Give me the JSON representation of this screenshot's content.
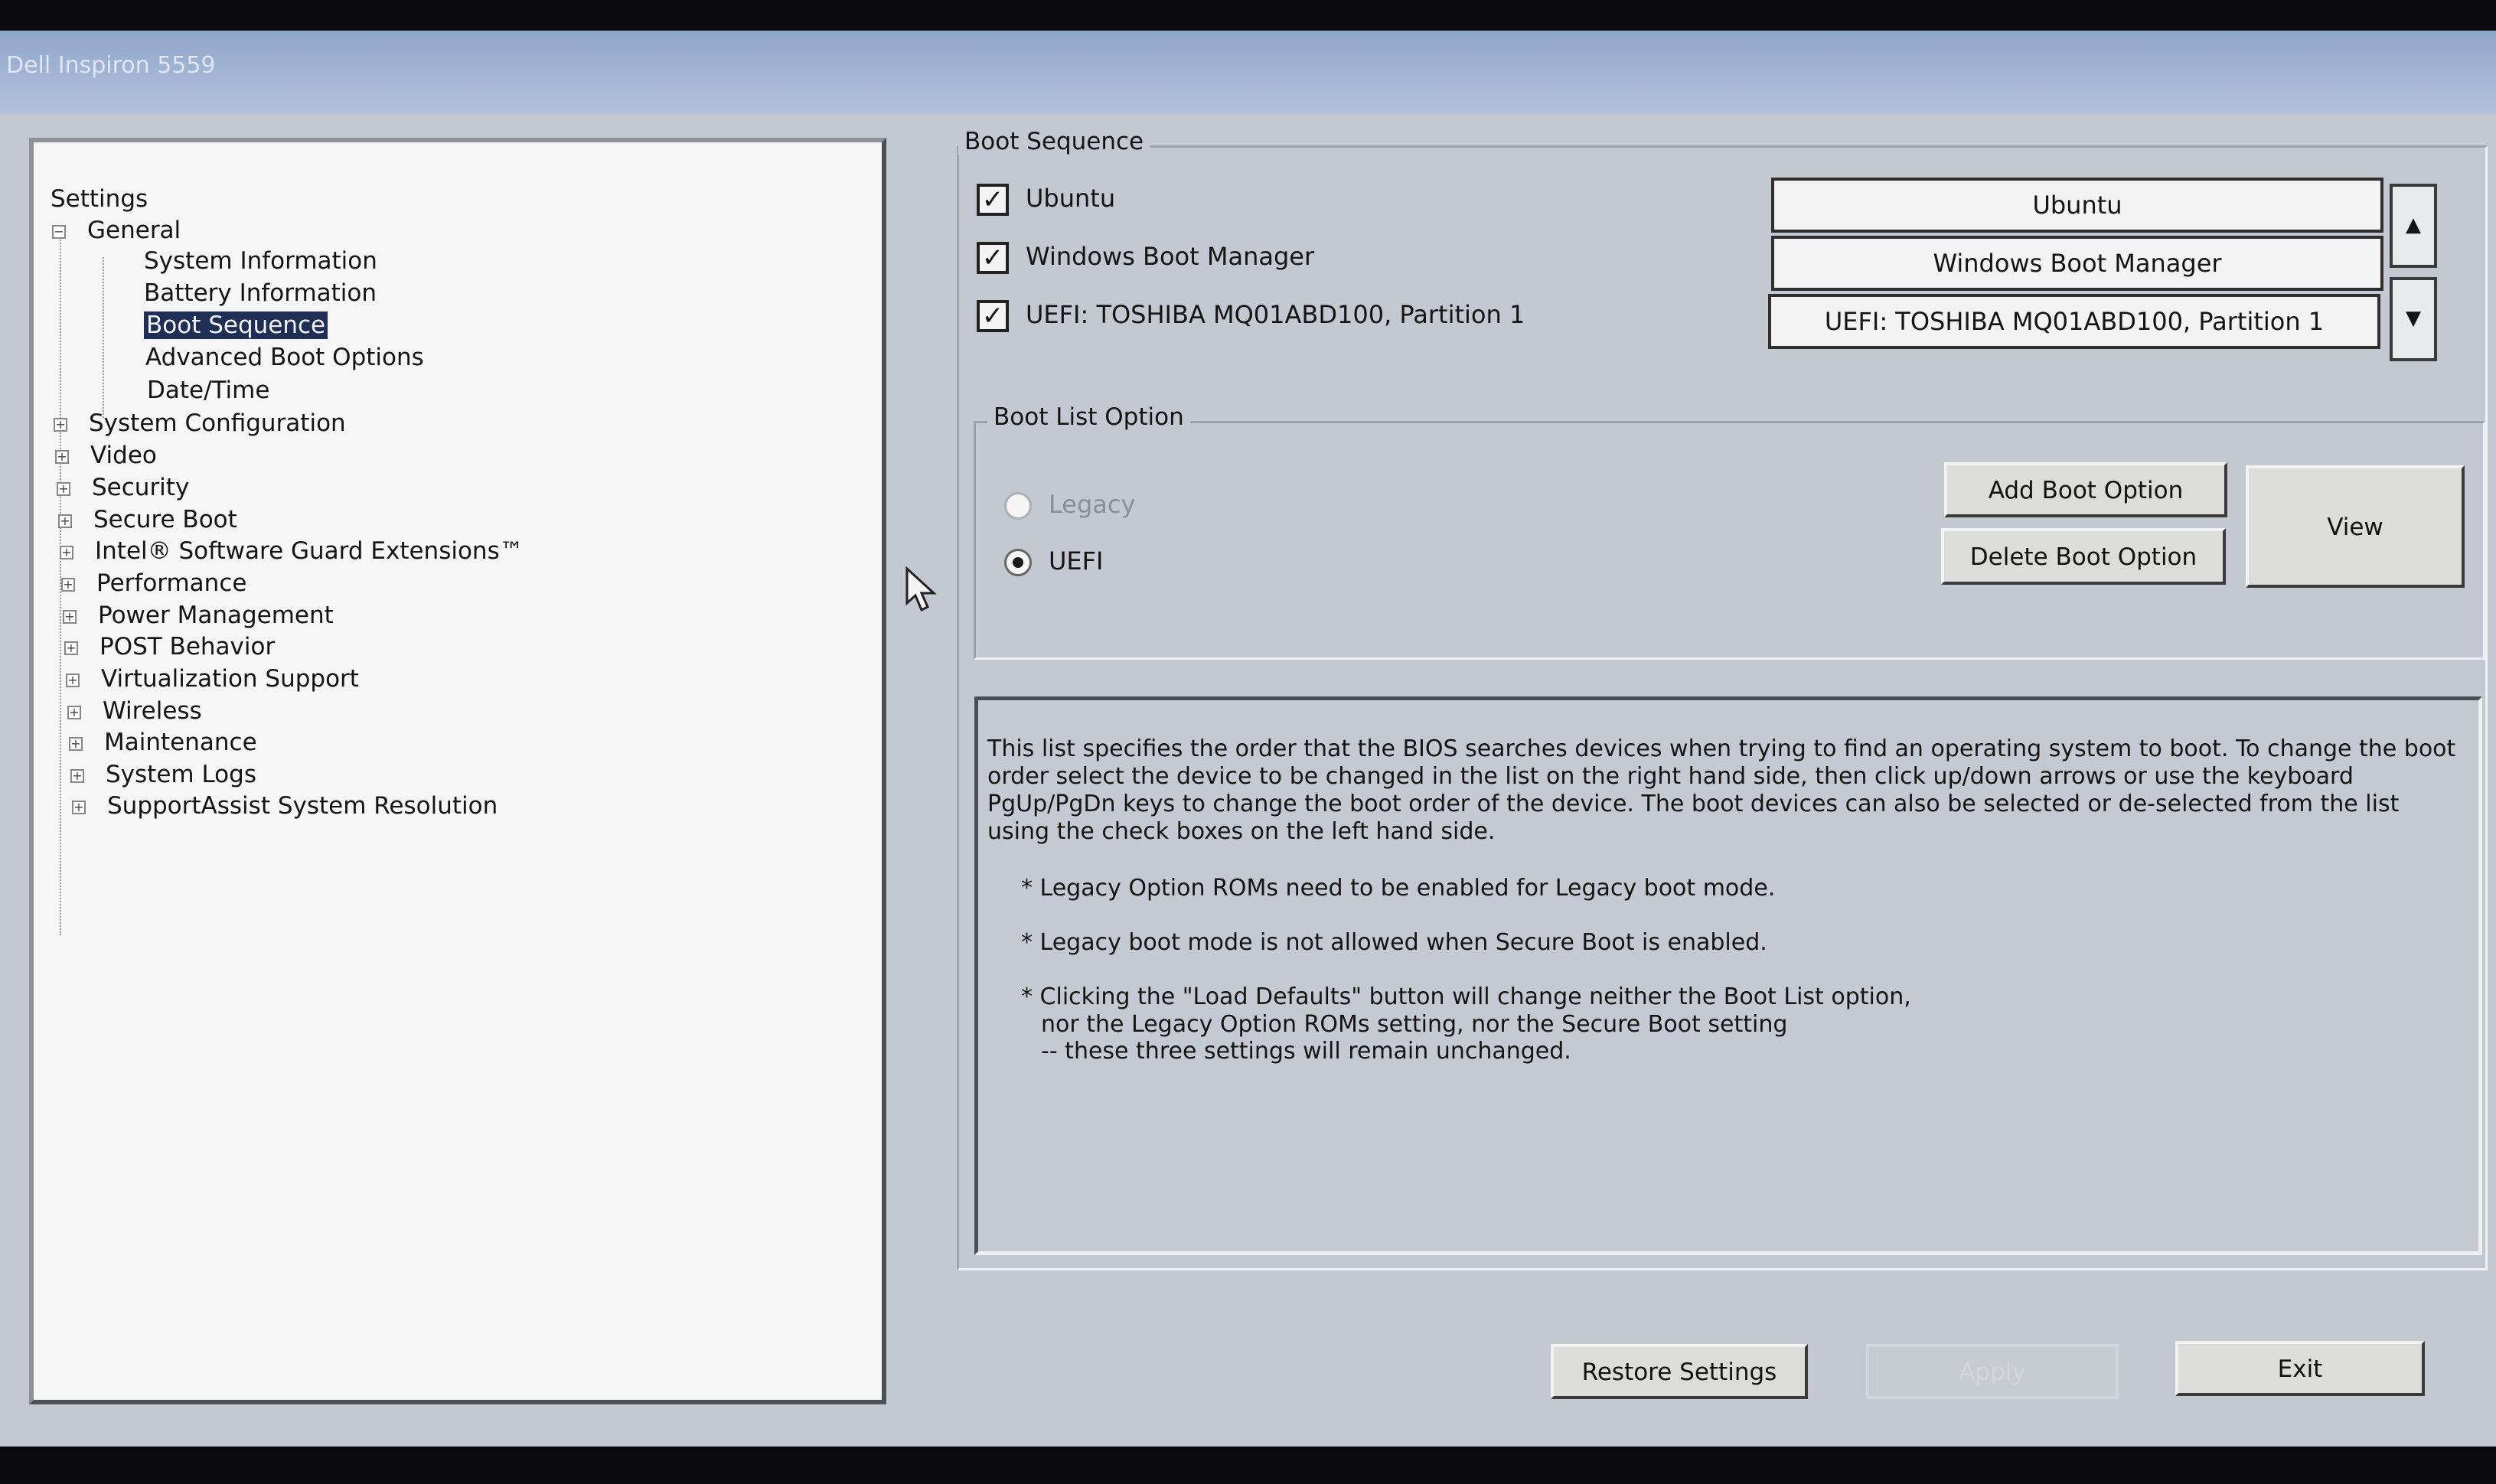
{
  "window": {
    "title": "Dell Inspiron 5559"
  },
  "tree": {
    "root": "Settings",
    "general": {
      "label": "General",
      "children": [
        "System Information",
        "Battery Information",
        "Boot Sequence",
        "Advanced Boot Options",
        "Date/Time"
      ],
      "selected": "Boot Sequence"
    },
    "groups": [
      "System Configuration",
      "Video",
      "Security",
      "Secure Boot",
      "Intel® Software Guard Extensions™",
      "Performance",
      "Power Management",
      "POST Behavior",
      "Virtualization Support",
      "Wireless",
      "Maintenance",
      "System Logs",
      "SupportAssist System Resolution"
    ]
  },
  "boot_sequence": {
    "legend": "Boot Sequence",
    "checked_items": [
      {
        "label": "Ubuntu",
        "checked": true
      },
      {
        "label": "Windows Boot Manager",
        "checked": true
      },
      {
        "label": "UEFI: TOSHIBA MQ01ABD100, Partition 1",
        "checked": true
      }
    ],
    "order_list": [
      "Ubuntu",
      "Windows Boot Manager",
      "UEFI: TOSHIBA MQ01ABD100, Partition 1"
    ]
  },
  "boot_list_option": {
    "legend": "Boot List Option",
    "options": [
      {
        "label": "Legacy",
        "selected": false,
        "enabled": false
      },
      {
        "label": "UEFI",
        "selected": true,
        "enabled": true
      }
    ],
    "add_label": "Add Boot Option",
    "delete_label": "Delete Boot Option",
    "view_label": "View"
  },
  "description": {
    "paragraph": "This list specifies the order that the BIOS searches devices when trying to find an operating system to boot. To change the boot order select the device to be changed in the list on the right hand side, then click up/down arrows or use the keyboard PgUp/PgDn keys to change the boot order of the device. The boot devices can also be selected or de-selected from the list using the check boxes on the left hand side.",
    "note1": "* Legacy Option ROMs need to be enabled for Legacy boot mode.",
    "note2": "* Legacy boot mode is not allowed when Secure Boot is enabled.",
    "note3_l1": "* Clicking the \"Load Defaults\" button will change neither the Boot List option,",
    "note3_l2": "nor the Legacy Option ROMs setting, nor the Secure Boot setting",
    "note3_l3": "-- these three settings will remain unchanged."
  },
  "footer": {
    "restore_label": "Restore Settings",
    "apply_label": "Apply",
    "exit_label": "Exit"
  },
  "colors": {
    "background": "#c4c8d0",
    "selection": "#1f2e55",
    "titlebar": "#9fb2d2"
  }
}
